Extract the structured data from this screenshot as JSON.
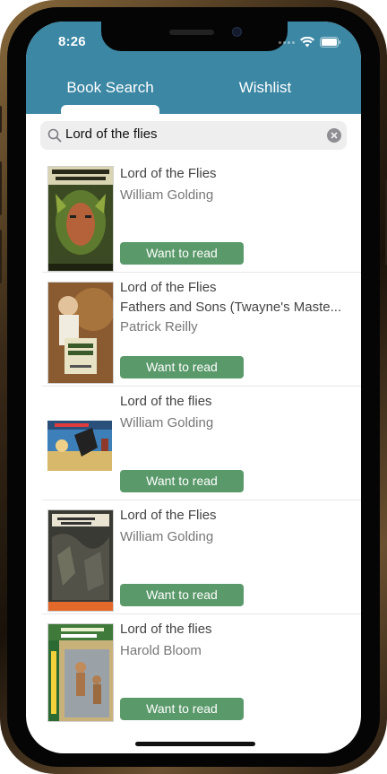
{
  "status_bar": {
    "time": "8:26"
  },
  "tabs": [
    {
      "label": "Book Search",
      "active": true
    },
    {
      "label": "Wishlist",
      "active": false
    }
  ],
  "search": {
    "value": "Lord of the flies",
    "icon": "magnifier-icon",
    "clear_icon": "clear-circle-icon"
  },
  "results": [
    {
      "title": "Lord of the Flies",
      "subtitle": "",
      "author": "William Golding",
      "button": "Want to read"
    },
    {
      "title": "Lord of the Flies",
      "subtitle": "Fathers and Sons (Twayne's Maste...",
      "author": "Patrick Reilly",
      "button": "Want to read"
    },
    {
      "title": "Lord of the flies",
      "subtitle": "",
      "author": "William Golding",
      "button": "Want to read"
    },
    {
      "title": "Lord of the Flies",
      "subtitle": "",
      "author": "William Golding",
      "button": "Want to read"
    },
    {
      "title": "Lord of the flies",
      "subtitle": "",
      "author": "Harold Bloom",
      "button": "Want to read"
    }
  ],
  "colors": {
    "header": "#3b87a4",
    "button": "#5a996a",
    "device_frame": "#8a6a3c"
  }
}
